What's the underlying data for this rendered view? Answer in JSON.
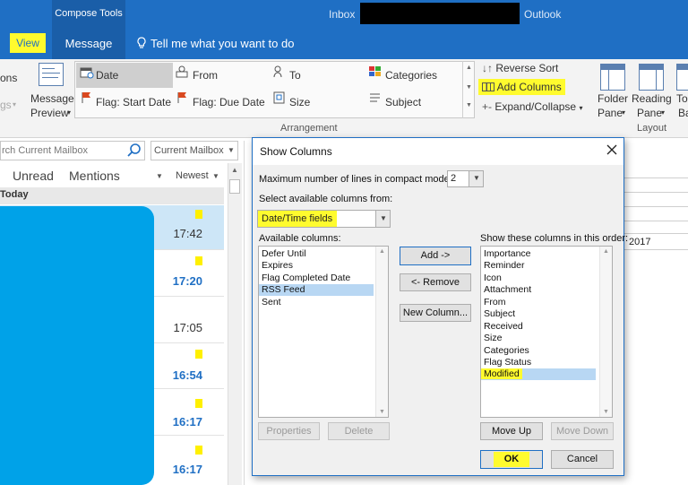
{
  "window": {
    "context_group": "Compose Tools",
    "title_folder": "Inbox",
    "title_app": "Outlook"
  },
  "tabs": {
    "view": "View",
    "message": "Message",
    "tell_me": "Tell me what you want to do"
  },
  "ribbon": {
    "left_partial_1": "ons",
    "left_partial_2": "gs",
    "message_preview_line1": "Message",
    "message_preview_line2": "Preview",
    "arrangement": {
      "label": "Arrangement",
      "date": "Date",
      "from": "From",
      "to": "To",
      "categories": "Categories",
      "flag_start": "Flag: Start Date",
      "flag_due": "Flag: Due Date",
      "size": "Size",
      "subject": "Subject"
    },
    "reverse_sort": "Reverse Sort",
    "add_columns": "Add Columns",
    "expand_collapse": "Expand/Collapse",
    "layout": {
      "label": "Layout",
      "folder_pane_1": "Folder",
      "folder_pane_2": "Pane",
      "reading_pane_1": "Reading",
      "reading_pane_2": "Pane",
      "todo_partial_1": "To",
      "todo_partial_2": "Ba"
    }
  },
  "mail_list": {
    "search_placeholder": "rch Current Mailbox",
    "scope": "Current Mailbox",
    "filter_unread": "Unread",
    "filter_mentions": "Mentions",
    "sort": "Newest",
    "group_today": "Today",
    "times": [
      "17:42",
      "17:20",
      "17:05",
      "16:54",
      "16:17",
      "16:17"
    ]
  },
  "reading_pane": {
    "year": "2017"
  },
  "dialog": {
    "title": "Show Columns",
    "max_lines_label": "Maximum number of lines in compact mode:",
    "max_lines_value": "2",
    "select_from_label": "Select available columns from:",
    "select_from_value": "Date/Time fields",
    "available_label": "Available columns:",
    "available_items": [
      "Defer Until",
      "Expires",
      "Flag Completed Date",
      "RSS Feed",
      "Sent"
    ],
    "selected_available": "RSS Feed",
    "show_label": "Show these columns in this order:",
    "show_items": [
      "Importance",
      "Reminder",
      "Icon",
      "Attachment",
      "From",
      "Subject",
      "Received",
      "Size",
      "Categories",
      "Flag Status",
      "Modified"
    ],
    "selected_show": "Modified",
    "buttons": {
      "add": "Add ->",
      "remove": "<- Remove",
      "new_column": "New Column...",
      "properties": "Properties",
      "delete": "Delete",
      "move_up": "Move Up",
      "move_down": "Move Down",
      "ok": "OK",
      "cancel": "Cancel"
    }
  },
  "colors": {
    "title_blue": "#1f6fc4",
    "highlight_yellow": "#fffb2e",
    "redaction_blue": "#00a2e8",
    "selection_blue": "#b8d7f3",
    "time_blue": "#1f6fc4"
  },
  "icons": {
    "close": "close-icon",
    "search": "search-icon",
    "lightbulb": "lightbulb-icon",
    "flag": "flag-icon"
  }
}
